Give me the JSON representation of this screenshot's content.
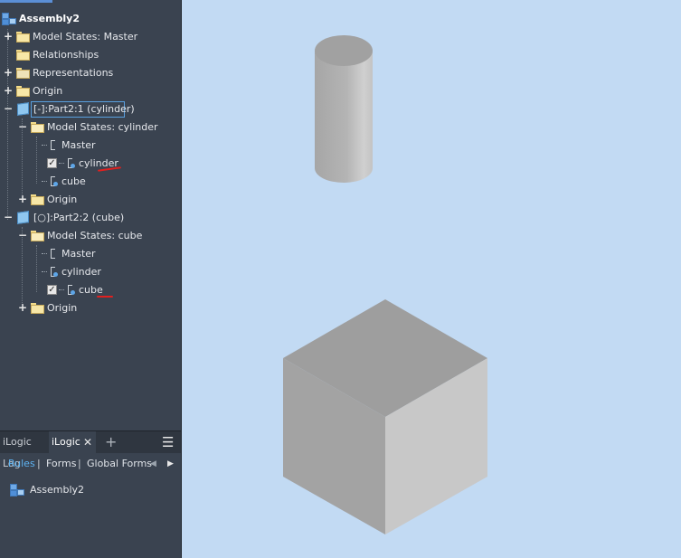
{
  "browser": {
    "root": {
      "label": "Assembly2"
    },
    "items": [
      {
        "label": "Model States: Master"
      },
      {
        "label": "Relationships"
      },
      {
        "label": "Representations"
      },
      {
        "label": "Origin"
      },
      {
        "label": "[-]:Part2:1 (cylinder)"
      },
      {
        "label": "Model States: cylinder"
      },
      {
        "label": "Master"
      },
      {
        "label": "cylinder"
      },
      {
        "label": "cube"
      },
      {
        "label": "Origin"
      },
      {
        "label": "[○]:Part2:2 (cube)"
      },
      {
        "label": "Model States: cube"
      },
      {
        "label": "Master"
      },
      {
        "label": "cylinder"
      },
      {
        "label": "cube"
      },
      {
        "label": "Origin"
      }
    ]
  },
  "bottom_panel": {
    "tabs": [
      {
        "label": "iLogic Log"
      },
      {
        "label": "iLogic"
      }
    ],
    "close_glyph": "✕",
    "add_glyph": "+",
    "menu_glyph": "☰",
    "subtabs": [
      {
        "label": "Rules"
      },
      {
        "label": "|"
      },
      {
        "label": "Forms"
      },
      {
        "label": "|"
      },
      {
        "label": "Global Forms"
      }
    ],
    "tree_item": {
      "label": "Assembly2"
    }
  },
  "colors": {
    "panel_bg": "#3a4350",
    "viewport_bg": "#c2daf3",
    "accent": "#5aa0e0",
    "annotation_red": "#e0201f"
  },
  "icons": [
    "assembly-icon",
    "folder-icon",
    "part-icon",
    "model-state-icon",
    "checkbox-icon",
    "expand-icon",
    "collapse-icon",
    "close-icon",
    "add-tab-icon",
    "menu-icon",
    "scroll-left-icon",
    "scroll-right-icon"
  ]
}
